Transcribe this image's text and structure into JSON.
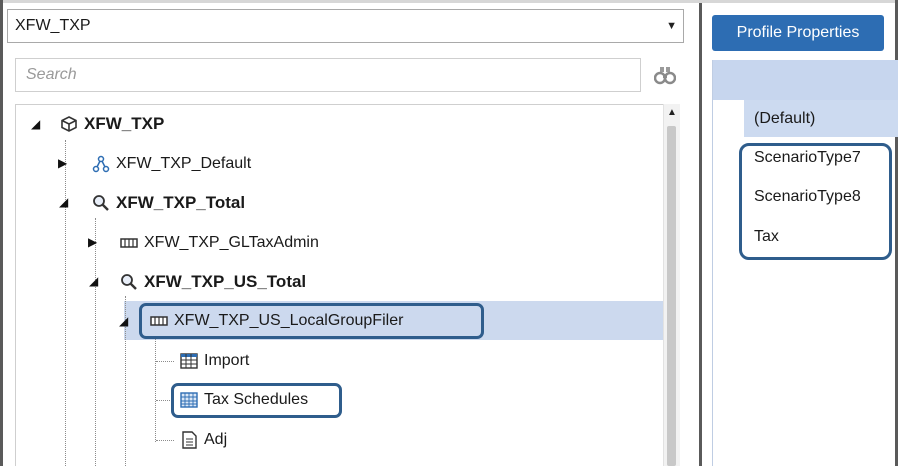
{
  "profile_selector": {
    "value": "XFW_TXP"
  },
  "search": {
    "placeholder": "Search"
  },
  "tree": {
    "root": "XFW_TXP",
    "default": "XFW_TXP_Default",
    "total": "XFW_TXP_Total",
    "gl_tax_admin": "XFW_TXP_GLTaxAdmin",
    "us_total": "XFW_TXP_US_Total",
    "local_group_filer": "XFW_TXP_US_LocalGroupFiler",
    "import": "Import",
    "tax_schedules": "Tax Schedules",
    "adj": "Adj"
  },
  "right_panel": {
    "button_label": "Profile Properties",
    "rows": [
      "(Default)",
      "ScenarioType7",
      "ScenarioType8",
      "Tax"
    ]
  },
  "colors": {
    "accent": "#2d6db3",
    "selection": "#ccd9ee",
    "highlight_border": "#2f5d8c"
  }
}
